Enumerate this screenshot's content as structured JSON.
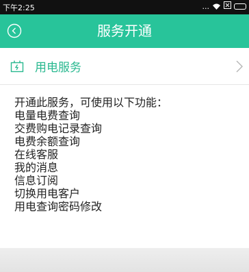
{
  "status_bar": {
    "time": "下午2:25",
    "dots": "..."
  },
  "header": {
    "title": "服务开通",
    "back_icon": "back-circle-icon",
    "background": "#28c49a"
  },
  "service_row": {
    "label": "用电服务",
    "icon": "power-plug-icon",
    "accent": "#28b88f"
  },
  "features": {
    "intro": "开通此服务，可使用以下功能：",
    "items": [
      "电量电费查询",
      "交费购电记录查询",
      "电费余额查询",
      "在线客服",
      "我的消息",
      "信息订阅",
      "切换用电客户",
      "用电查询密码修改"
    ]
  }
}
